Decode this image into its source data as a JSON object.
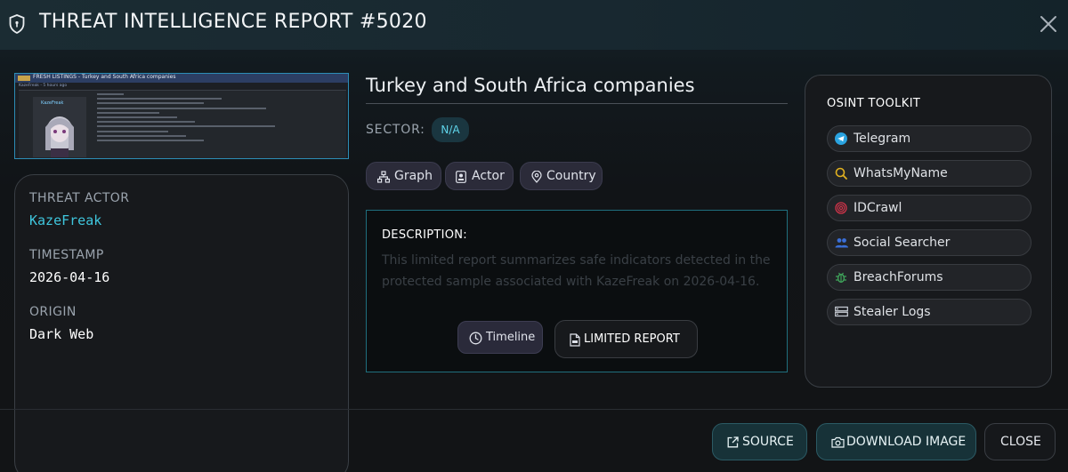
{
  "header": {
    "title": "THREAT INTELLIGENCE REPORT #5020",
    "shield_icon": "shield-icon",
    "close_icon": "close-icon"
  },
  "thumbnail": {
    "heading": "FRESH LISTINGS - Turkey and South Africa companies",
    "subline": "KazeFreak - 5 hours ago",
    "username": "KazeFreak"
  },
  "info": {
    "actor_label": "THREAT ACTOR",
    "actor_value": "KazeFreak",
    "timestamp_label": "TIMESTAMP",
    "timestamp_value": "2026-04-16",
    "origin_label": "ORIGIN",
    "origin_value": "Dark Web"
  },
  "report": {
    "title": "Turkey and South Africa companies",
    "sector_label": "SECTOR:",
    "sector_value": "N/A",
    "pills": {
      "graph": "Graph",
      "actor": "Actor",
      "country": "Country"
    }
  },
  "description": {
    "title": "DESCRIPTION:",
    "text": "This limited report summarizes safe indicators detected in the protected sample associated with KazeFreak on 2026-04-16.",
    "timeline_label": "Timeline",
    "limited_label": "LIMITED REPORT"
  },
  "toolkit": {
    "title": "OSINT TOOLKIT",
    "tools": [
      {
        "label": "Telegram",
        "icon": "telegram-icon",
        "color": "#2aa3e0"
      },
      {
        "label": "WhatsMyName",
        "icon": "search-icon",
        "color": "#e0b020"
      },
      {
        "label": "IDCrawl",
        "icon": "fingerprint-icon",
        "color": "#d2344a"
      },
      {
        "label": "Social Searcher",
        "icon": "users-icon",
        "color": "#3a6fd8"
      },
      {
        "label": "BreachForums",
        "icon": "bug-icon",
        "color": "#3fa35a"
      },
      {
        "label": "Stealer Logs",
        "icon": "server-icon",
        "color": "#c9ced6"
      }
    ]
  },
  "footer": {
    "source_label": "SOURCE",
    "download_label": "DOWNLOAD IMAGE",
    "close_label": "CLOSE"
  },
  "colors": {
    "accent": "#3fc6dd",
    "actor_text": "#3fc6dd",
    "desc_border": "#1f6f7e"
  }
}
